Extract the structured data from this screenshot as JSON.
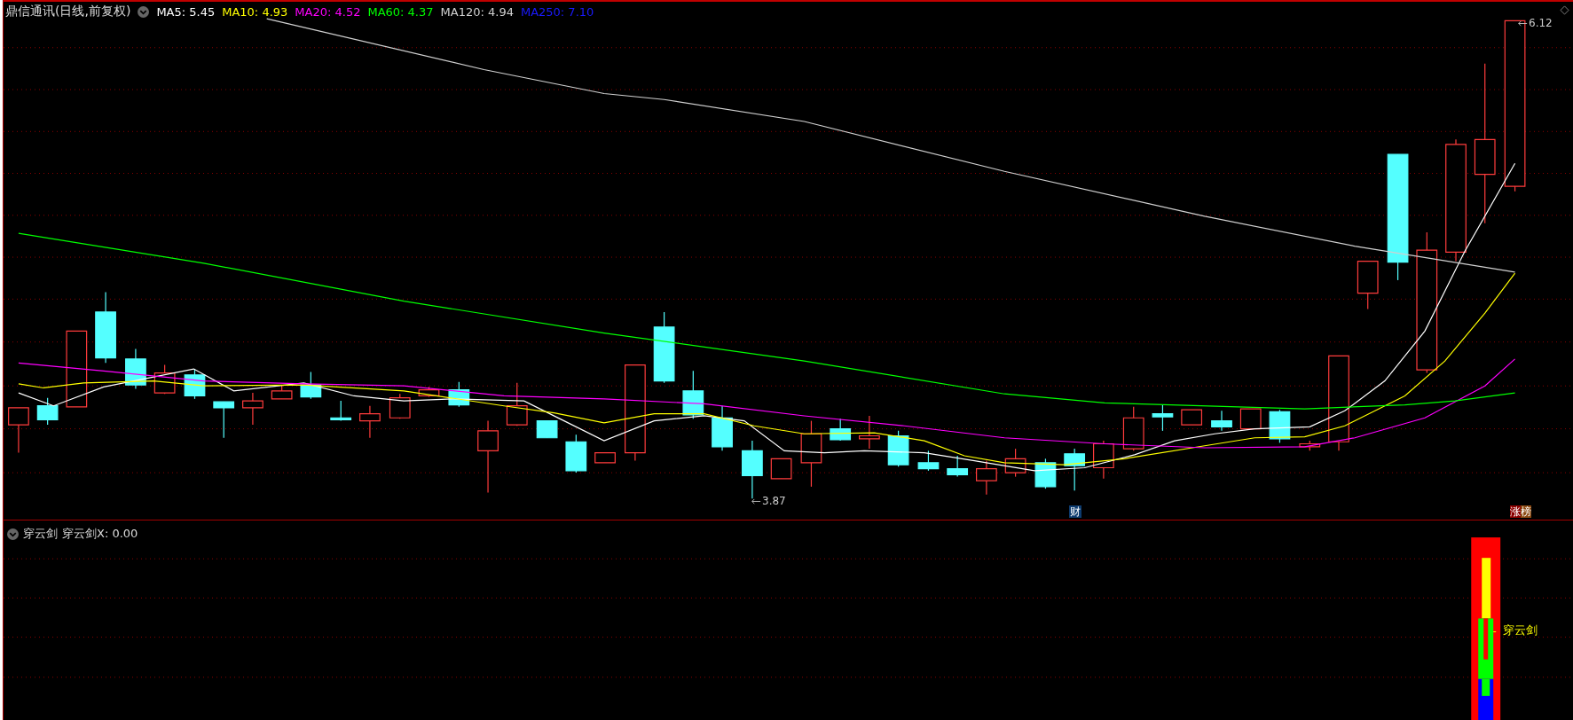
{
  "header": {
    "title": "鼎信通讯(日线,前复权)",
    "indicators": [
      {
        "label": "MA5: 5.45",
        "color": "#ffffff"
      },
      {
        "label": "MA10: 4.93",
        "color": "#ffff00"
      },
      {
        "label": "MA20: 4.52",
        "color": "#ff00ff"
      },
      {
        "label": "MA60: 4.37",
        "color": "#00ff00"
      },
      {
        "label": "MA120: 4.94",
        "color": "#d0d0d0"
      },
      {
        "label": "MA250: 7.10",
        "color": "#1a1aff"
      }
    ]
  },
  "price_chart": {
    "high_label": "6.12",
    "low_label": "3.87",
    "finance_badge": "财",
    "rank_badges": [
      "涨",
      "榜"
    ]
  },
  "indicator_panel": {
    "name": "穿云剑",
    "reading": "穿云剑X: 0.00",
    "signal_label": "穿云剑"
  }
}
